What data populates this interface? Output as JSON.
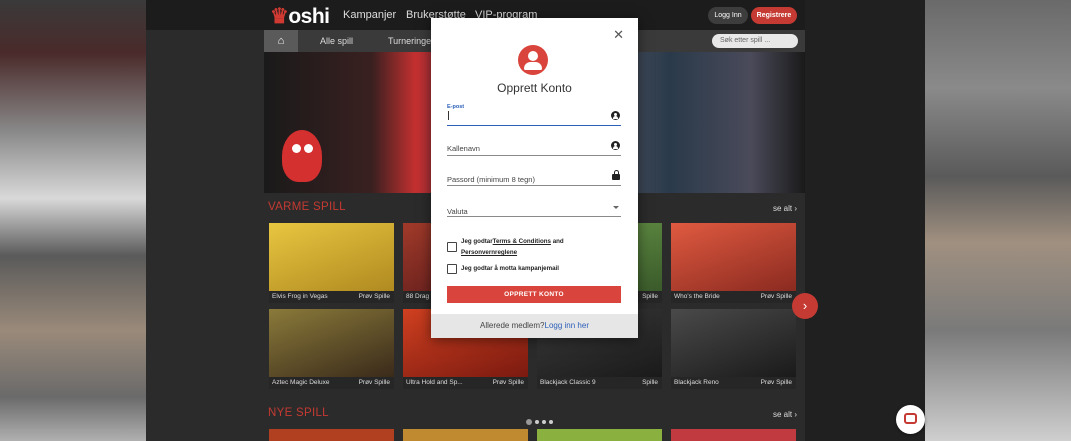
{
  "header": {
    "logo": "oshi",
    "nav": [
      "Kampanjer",
      "Brukerstøtte",
      "VIP-program"
    ],
    "login_label": "Logg Inn",
    "register_label": "Registrere"
  },
  "subnav": {
    "items": [
      "Alle spill",
      "Turneringer"
    ],
    "search_placeholder": "Søk etter spill ..."
  },
  "sections": [
    {
      "title": "VARME SPILL",
      "see_all": "se alt"
    },
    {
      "title": "NYE SPILL",
      "see_all": "se alt"
    }
  ],
  "tiles_row1": [
    {
      "name": "Elvis Frog in Vegas",
      "actions": "Prøv  Spille",
      "color": "#d9b03a"
    },
    {
      "name": "88 Drag",
      "actions": "",
      "color": "#8a2a2a"
    },
    {
      "name": "",
      "actions": "Spille",
      "color": "#5a8a3a"
    },
    {
      "name": "Who's the Bride",
      "actions": "Prøv  Spille",
      "color": "#c53a32"
    }
  ],
  "tiles_row2": [
    {
      "name": "Aztec Magic Deluxe",
      "actions": "Prøv  Spille",
      "color": "#6a5a2a"
    },
    {
      "name": "Ultra Hold and Sp...",
      "actions": "Prøv  Spille",
      "color": "#b03020"
    },
    {
      "name": "Blackjack Classic 9",
      "actions": "Spille",
      "color": "#2a2a2a"
    },
    {
      "name": "Blackjack Reno",
      "actions": "Prøv  Spille",
      "color": "#3a3a3a"
    }
  ],
  "modal": {
    "title": "Opprett Konto",
    "email_label": "E-post",
    "nickname_label": "Kallenavn",
    "password_label": "Passord (minimum 8 tegn)",
    "currency_label": "Valuta",
    "terms_prefix": "Jeg godtar",
    "terms_link": "Terms & Conditions",
    "terms_and": "and",
    "privacy_link": "Personvernreglene",
    "promo_label": "Jeg godtar å motta kampanjemail",
    "submit_label": "OPPRETT KONTO",
    "footer_text": "Allerede medlem?",
    "footer_link": "Logg inn her"
  },
  "colors": {
    "accent": "#d9453c",
    "link": "#2b5fb8"
  }
}
